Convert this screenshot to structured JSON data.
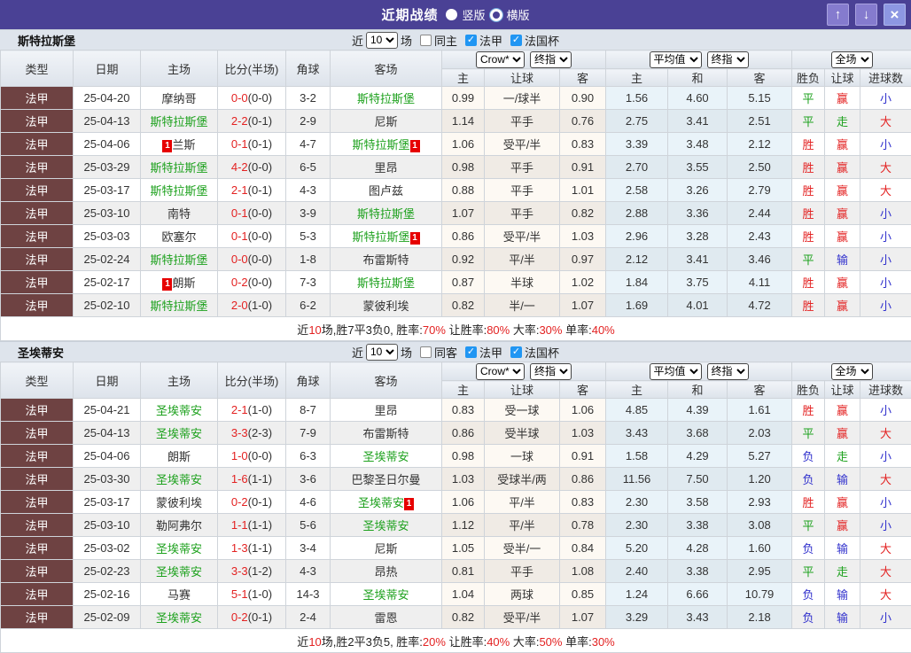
{
  "icons": {
    "up": "↑",
    "down": "↓",
    "close": "×",
    "check": "✓"
  },
  "colors": {
    "titlebar_bg": "#4a4195",
    "nav_button_bg": "#857bce",
    "close_button_bg": "#8d97e2",
    "section_header_bg": "#dee4ec",
    "type_cell_bg": "#6e4242",
    "win_red": "#e32222",
    "draw_green": "#1da11d",
    "lose_blue": "#3232cd",
    "team_green": "#1da11d",
    "checkbox_blue": "#2196f3"
  },
  "titlebar": {
    "title": "近期战绩",
    "radios": [
      {
        "label": "竖版",
        "selected": true
      },
      {
        "label": "横版",
        "selected": false
      }
    ]
  },
  "columns": {
    "main": [
      "类型",
      "日期",
      "主场",
      "比分(半场)",
      "角球",
      "客场"
    ],
    "groups": [
      {
        "selects": [
          "Crow*",
          "终指"
        ],
        "cols": [
          "主",
          "让球",
          "客"
        ]
      },
      {
        "selects": [
          "平均值",
          "终指"
        ],
        "cols": [
          "主",
          "和",
          "客"
        ]
      },
      {
        "selects": [
          "全场"
        ],
        "cols": [
          "胜负",
          "让球",
          "进球数"
        ]
      }
    ]
  },
  "sections": [
    {
      "team": "斯特拉斯堡",
      "filter": {
        "prefix": "近",
        "games": "10",
        "suffix": "场",
        "same": {
          "label": "同主",
          "checked": false
        },
        "leagues": [
          {
            "label": "法甲",
            "checked": true
          },
          {
            "label": "法国杯",
            "checked": true
          }
        ]
      },
      "rows": [
        {
          "league": "法甲",
          "date": "25-04-20",
          "home": {
            "name": "摩纳哥"
          },
          "score_ft": "0-0",
          "score_ht": "(0-0)",
          "corners": "3-2",
          "away": {
            "name": "斯特拉斯堡",
            "green": true
          },
          "odds": [
            "0.99",
            "一/球半",
            "0.90"
          ],
          "avg": [
            "1.56",
            "4.60",
            "5.15"
          ],
          "results": [
            [
              "平",
              "green"
            ],
            [
              "赢",
              "red"
            ],
            [
              "小",
              "blue"
            ]
          ]
        },
        {
          "league": "法甲",
          "date": "25-04-13",
          "home": {
            "name": "斯特拉斯堡",
            "green": true
          },
          "score_ft": "2-2",
          "score_ht": "(0-1)",
          "corners": "2-9",
          "away": {
            "name": "尼斯"
          },
          "odds": [
            "1.14",
            "平手",
            "0.76"
          ],
          "avg": [
            "2.75",
            "3.41",
            "2.51"
          ],
          "results": [
            [
              "平",
              "green"
            ],
            [
              "走",
              "green"
            ],
            [
              "大",
              "red"
            ]
          ]
        },
        {
          "league": "法甲",
          "date": "25-04-06",
          "home": {
            "name": "兰斯",
            "card": "before"
          },
          "score_ft": "0-1",
          "score_ht": "(0-1)",
          "corners": "4-7",
          "away": {
            "name": "斯特拉斯堡",
            "green": true,
            "card": "after"
          },
          "odds": [
            "1.06",
            "受平/半",
            "0.83"
          ],
          "avg": [
            "3.39",
            "3.48",
            "2.12"
          ],
          "results": [
            [
              "胜",
              "red"
            ],
            [
              "赢",
              "red"
            ],
            [
              "小",
              "blue"
            ]
          ]
        },
        {
          "league": "法甲",
          "date": "25-03-29",
          "home": {
            "name": "斯特拉斯堡",
            "green": true
          },
          "score_ft": "4-2",
          "score_ht": "(0-0)",
          "corners": "6-5",
          "away": {
            "name": "里昂"
          },
          "odds": [
            "0.98",
            "平手",
            "0.91"
          ],
          "avg": [
            "2.70",
            "3.55",
            "2.50"
          ],
          "results": [
            [
              "胜",
              "red"
            ],
            [
              "赢",
              "red"
            ],
            [
              "大",
              "red"
            ]
          ]
        },
        {
          "league": "法甲",
          "date": "25-03-17",
          "home": {
            "name": "斯特拉斯堡",
            "green": true
          },
          "score_ft": "2-1",
          "score_ht": "(0-1)",
          "corners": "4-3",
          "away": {
            "name": "图卢兹"
          },
          "odds": [
            "0.88",
            "平手",
            "1.01"
          ],
          "avg": [
            "2.58",
            "3.26",
            "2.79"
          ],
          "results": [
            [
              "胜",
              "red"
            ],
            [
              "赢",
              "red"
            ],
            [
              "大",
              "red"
            ]
          ]
        },
        {
          "league": "法甲",
          "date": "25-03-10",
          "home": {
            "name": "南特"
          },
          "score_ft": "0-1",
          "score_ht": "(0-0)",
          "corners": "3-9",
          "away": {
            "name": "斯特拉斯堡",
            "green": true
          },
          "odds": [
            "1.07",
            "平手",
            "0.82"
          ],
          "avg": [
            "2.88",
            "3.36",
            "2.44"
          ],
          "results": [
            [
              "胜",
              "red"
            ],
            [
              "赢",
              "red"
            ],
            [
              "小",
              "blue"
            ]
          ]
        },
        {
          "league": "法甲",
          "date": "25-03-03",
          "home": {
            "name": "欧塞尔"
          },
          "score_ft": "0-1",
          "score_ht": "(0-0)",
          "corners": "5-3",
          "away": {
            "name": "斯特拉斯堡",
            "green": true,
            "card": "after"
          },
          "odds": [
            "0.86",
            "受平/半",
            "1.03"
          ],
          "avg": [
            "2.96",
            "3.28",
            "2.43"
          ],
          "results": [
            [
              "胜",
              "red"
            ],
            [
              "赢",
              "red"
            ],
            [
              "小",
              "blue"
            ]
          ]
        },
        {
          "league": "法甲",
          "date": "25-02-24",
          "home": {
            "name": "斯特拉斯堡",
            "green": true
          },
          "score_ft": "0-0",
          "score_ht": "(0-0)",
          "corners": "1-8",
          "away": {
            "name": "布雷斯特"
          },
          "odds": [
            "0.92",
            "平/半",
            "0.97"
          ],
          "avg": [
            "2.12",
            "3.41",
            "3.46"
          ],
          "results": [
            [
              "平",
              "green"
            ],
            [
              "输",
              "blue"
            ],
            [
              "小",
              "blue"
            ]
          ]
        },
        {
          "league": "法甲",
          "date": "25-02-17",
          "home": {
            "name": "朗斯",
            "card": "before"
          },
          "score_ft": "0-2",
          "score_ht": "(0-0)",
          "corners": "7-3",
          "away": {
            "name": "斯特拉斯堡",
            "green": true
          },
          "odds": [
            "0.87",
            "半球",
            "1.02"
          ],
          "avg": [
            "1.84",
            "3.75",
            "4.11"
          ],
          "results": [
            [
              "胜",
              "red"
            ],
            [
              "赢",
              "red"
            ],
            [
              "小",
              "blue"
            ]
          ]
        },
        {
          "league": "法甲",
          "date": "25-02-10",
          "home": {
            "name": "斯特拉斯堡",
            "green": true
          },
          "score_ft": "2-0",
          "score_ht": "(1-0)",
          "corners": "6-2",
          "away": {
            "name": "蒙彼利埃"
          },
          "odds": [
            "0.82",
            "半/一",
            "1.07"
          ],
          "avg": [
            "1.69",
            "4.01",
            "4.72"
          ],
          "results": [
            [
              "胜",
              "red"
            ],
            [
              "赢",
              "red"
            ],
            [
              "小",
              "blue"
            ]
          ]
        }
      ],
      "summary": [
        "近",
        "10",
        "场,胜7平3负0, 胜率:",
        "70%",
        " 让胜率:",
        "80%",
        " 大率:",
        "30%",
        " 单率:",
        "40%"
      ]
    },
    {
      "team": "圣埃蒂安",
      "filter": {
        "prefix": "近",
        "games": "10",
        "suffix": "场",
        "same": {
          "label": "同客",
          "checked": false
        },
        "leagues": [
          {
            "label": "法甲",
            "checked": true
          },
          {
            "label": "法国杯",
            "checked": true
          }
        ]
      },
      "rows": [
        {
          "league": "法甲",
          "date": "25-04-21",
          "home": {
            "name": "圣埃蒂安",
            "green": true
          },
          "score_ft": "2-1",
          "score_ht": "(1-0)",
          "corners": "8-7",
          "away": {
            "name": "里昂"
          },
          "odds": [
            "0.83",
            "受一球",
            "1.06"
          ],
          "avg": [
            "4.85",
            "4.39",
            "1.61"
          ],
          "results": [
            [
              "胜",
              "red"
            ],
            [
              "赢",
              "red"
            ],
            [
              "小",
              "blue"
            ]
          ]
        },
        {
          "league": "法甲",
          "date": "25-04-13",
          "home": {
            "name": "圣埃蒂安",
            "green": true
          },
          "score_ft": "3-3",
          "score_ht": "(2-3)",
          "corners": "7-9",
          "away": {
            "name": "布雷斯特"
          },
          "odds": [
            "0.86",
            "受半球",
            "1.03"
          ],
          "avg": [
            "3.43",
            "3.68",
            "2.03"
          ],
          "results": [
            [
              "平",
              "green"
            ],
            [
              "赢",
              "red"
            ],
            [
              "大",
              "red"
            ]
          ]
        },
        {
          "league": "法甲",
          "date": "25-04-06",
          "home": {
            "name": "朗斯"
          },
          "score_ft": "1-0",
          "score_ht": "(0-0)",
          "corners": "6-3",
          "away": {
            "name": "圣埃蒂安",
            "green": true
          },
          "odds": [
            "0.98",
            "一球",
            "0.91"
          ],
          "avg": [
            "1.58",
            "4.29",
            "5.27"
          ],
          "results": [
            [
              "负",
              "blue"
            ],
            [
              "走",
              "green"
            ],
            [
              "小",
              "blue"
            ]
          ]
        },
        {
          "league": "法甲",
          "date": "25-03-30",
          "home": {
            "name": "圣埃蒂安",
            "green": true
          },
          "score_ft": "1-6",
          "score_ht": "(1-1)",
          "corners": "3-6",
          "away": {
            "name": "巴黎圣日尔曼"
          },
          "odds": [
            "1.03",
            "受球半/两",
            "0.86"
          ],
          "avg": [
            "11.56",
            "7.50",
            "1.20"
          ],
          "results": [
            [
              "负",
              "blue"
            ],
            [
              "输",
              "blue"
            ],
            [
              "大",
              "red"
            ]
          ]
        },
        {
          "league": "法甲",
          "date": "25-03-17",
          "home": {
            "name": "蒙彼利埃"
          },
          "score_ft": "0-2",
          "score_ht": "(0-1)",
          "corners": "4-6",
          "away": {
            "name": "圣埃蒂安",
            "green": true,
            "card": "after"
          },
          "odds": [
            "1.06",
            "平/半",
            "0.83"
          ],
          "avg": [
            "2.30",
            "3.58",
            "2.93"
          ],
          "results": [
            [
              "胜",
              "red"
            ],
            [
              "赢",
              "red"
            ],
            [
              "小",
              "blue"
            ]
          ]
        },
        {
          "league": "法甲",
          "date": "25-03-10",
          "home": {
            "name": "勒阿弗尔"
          },
          "score_ft": "1-1",
          "score_ht": "(1-1)",
          "corners": "5-6",
          "away": {
            "name": "圣埃蒂安",
            "green": true
          },
          "odds": [
            "1.12",
            "平/半",
            "0.78"
          ],
          "avg": [
            "2.30",
            "3.38",
            "3.08"
          ],
          "results": [
            [
              "平",
              "green"
            ],
            [
              "赢",
              "red"
            ],
            [
              "小",
              "blue"
            ]
          ]
        },
        {
          "league": "法甲",
          "date": "25-03-02",
          "home": {
            "name": "圣埃蒂安",
            "green": true
          },
          "score_ft": "1-3",
          "score_ht": "(1-1)",
          "corners": "3-4",
          "away": {
            "name": "尼斯"
          },
          "odds": [
            "1.05",
            "受半/一",
            "0.84"
          ],
          "avg": [
            "5.20",
            "4.28",
            "1.60"
          ],
          "results": [
            [
              "负",
              "blue"
            ],
            [
              "输",
              "blue"
            ],
            [
              "大",
              "red"
            ]
          ]
        },
        {
          "league": "法甲",
          "date": "25-02-23",
          "home": {
            "name": "圣埃蒂安",
            "green": true
          },
          "score_ft": "3-3",
          "score_ht": "(1-2)",
          "corners": "4-3",
          "away": {
            "name": "昂热"
          },
          "odds": [
            "0.81",
            "平手",
            "1.08"
          ],
          "avg": [
            "2.40",
            "3.38",
            "2.95"
          ],
          "results": [
            [
              "平",
              "green"
            ],
            [
              "走",
              "green"
            ],
            [
              "大",
              "red"
            ]
          ]
        },
        {
          "league": "法甲",
          "date": "25-02-16",
          "home": {
            "name": "马赛"
          },
          "score_ft": "5-1",
          "score_ht": "(1-0)",
          "corners": "14-3",
          "away": {
            "name": "圣埃蒂安",
            "green": true
          },
          "odds": [
            "1.04",
            "两球",
            "0.85"
          ],
          "avg": [
            "1.24",
            "6.66",
            "10.79"
          ],
          "results": [
            [
              "负",
              "blue"
            ],
            [
              "输",
              "blue"
            ],
            [
              "大",
              "red"
            ]
          ]
        },
        {
          "league": "法甲",
          "date": "25-02-09",
          "home": {
            "name": "圣埃蒂安",
            "green": true
          },
          "score_ft": "0-2",
          "score_ht": "(0-1)",
          "corners": "2-4",
          "away": {
            "name": "雷恩"
          },
          "odds": [
            "0.82",
            "受平/半",
            "1.07"
          ],
          "avg": [
            "3.29",
            "3.43",
            "2.18"
          ],
          "results": [
            [
              "负",
              "blue"
            ],
            [
              "输",
              "blue"
            ],
            [
              "小",
              "blue"
            ]
          ]
        }
      ],
      "summary": [
        "近",
        "10",
        "场,胜2平3负5, 胜率:",
        "20%",
        " 让胜率:",
        "40%",
        " 大率:",
        "50%",
        " 单率:",
        "30%"
      ]
    }
  ]
}
